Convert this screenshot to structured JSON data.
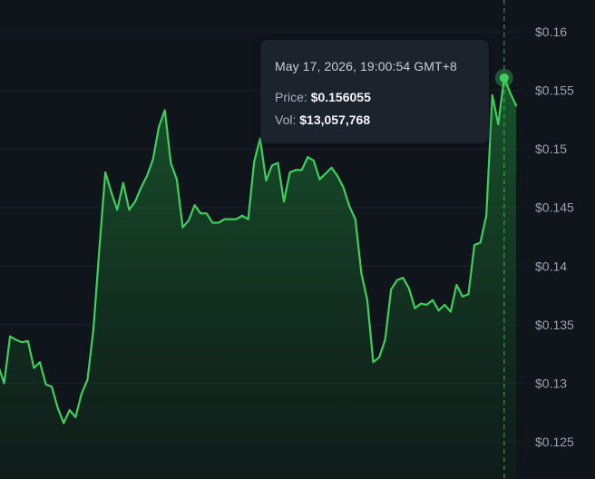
{
  "chart_data": {
    "type": "area",
    "title": "",
    "xlabel": "",
    "ylabel": "",
    "ylim": [
      0.123,
      0.1615
    ],
    "yticks": [
      0.16,
      0.155,
      0.15,
      0.145,
      0.14,
      0.135,
      0.13,
      0.125
    ],
    "ytick_labels": [
      "$0.16",
      "$0.155",
      "$0.15",
      "$0.145",
      "$0.14",
      "$0.135",
      "$0.13",
      "$0.125"
    ],
    "grid": true,
    "line_color": "#3ecf5c",
    "series": [
      {
        "values": [
          0.1315,
          0.13,
          0.134,
          0.1337,
          0.1335,
          0.1336,
          0.1313,
          0.1318,
          0.1299,
          0.1297,
          0.1279,
          0.1266,
          0.1277,
          0.1271,
          0.1291,
          0.1303,
          0.1346,
          0.1415,
          0.148,
          0.1463,
          0.1448,
          0.1471,
          0.1448,
          0.1455,
          0.1467,
          0.1477,
          0.1491,
          0.1519,
          0.1533,
          0.1488,
          0.1474,
          0.1433,
          0.1439,
          0.1452,
          0.1445,
          0.1445,
          0.1437,
          0.1437,
          0.144,
          0.144,
          0.144,
          0.1443,
          0.144,
          0.1489,
          0.1509,
          0.1473,
          0.1486,
          0.1488,
          0.1455,
          0.148,
          0.1482,
          0.1482,
          0.1493,
          0.149,
          0.1474,
          0.1479,
          0.1484,
          0.1477,
          0.1467,
          0.1451,
          0.144,
          0.1394,
          0.1371,
          0.1318,
          0.1322,
          0.1337,
          0.138,
          0.1388,
          0.139,
          0.1381,
          0.1364,
          0.1368,
          0.1367,
          0.1371,
          0.1362,
          0.1367,
          0.1361,
          0.1384,
          0.1374,
          0.1376,
          0.1418,
          0.142,
          0.1443,
          0.1546,
          0.1521,
          0.156055,
          0.1548,
          0.1537
        ]
      }
    ],
    "tooltip": {
      "date": "May 17, 2026, 19:00:54 GMT+8",
      "price_label": "Price:",
      "price_value": "$0.156055",
      "vol_label": "Vol:",
      "vol_value": "$13,057,768"
    },
    "highlight_index": 85
  }
}
